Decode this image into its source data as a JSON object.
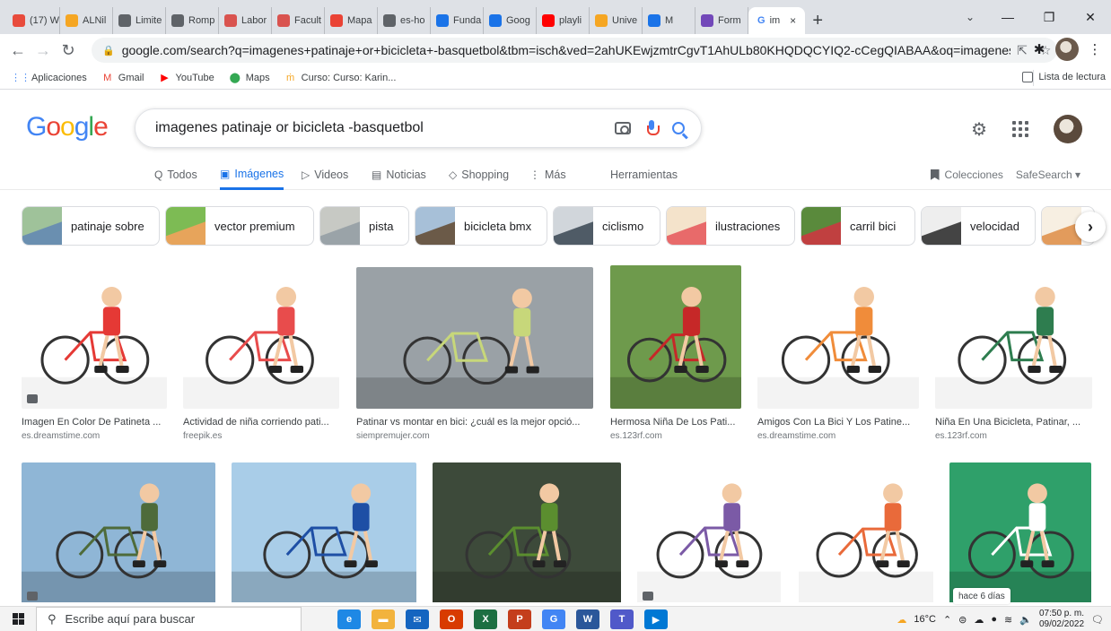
{
  "browser": {
    "tabs": [
      {
        "label": "(17) W",
        "color": "#e84b3c"
      },
      {
        "label": "ALNil",
        "color": "#f5a623"
      },
      {
        "label": "Limite",
        "color": "#5f6368"
      },
      {
        "label": "Romp",
        "color": "#5f6368"
      },
      {
        "label": "Labor",
        "color": "#d9534f"
      },
      {
        "label": "Facult",
        "color": "#d9534f"
      },
      {
        "label": "Mapa",
        "color": "#ea4335"
      },
      {
        "label": "es-ho",
        "color": "#5f6368"
      },
      {
        "label": "Funda",
        "color": "#1a73e8"
      },
      {
        "label": "Goog",
        "color": "#1a73e8"
      },
      {
        "label": "playli",
        "color": "#ff0000"
      },
      {
        "label": "Unive",
        "color": "#f5a623"
      },
      {
        "label": "M",
        "color": "#1a73e8"
      },
      {
        "label": "Form",
        "color": "#7248b9"
      }
    ],
    "active_tab": {
      "label": "im",
      "close": "×"
    },
    "new_tab": "+",
    "url": "google.com/search?q=imagenes+patinaje+or+bicicleta+-basquetbol&tbm=isch&ved=2ahUKEwjzmtrCgvT1AhULb80KHQDQCYIQ2-cCegQIABAA&oq=imagenes+patin...",
    "bookmarks": [
      {
        "label": "Aplicaciones",
        "icon": "apps-grid-icon",
        "color": "#4285f4"
      },
      {
        "label": "Gmail",
        "icon": "gmail-icon",
        "color": "#ea4335"
      },
      {
        "label": "YouTube",
        "icon": "youtube-icon",
        "color": "#ff0000"
      },
      {
        "label": "Maps",
        "icon": "maps-pin-icon",
        "color": "#34a853"
      },
      {
        "label": "Curso: Curso: Karin...",
        "icon": "moodle-icon",
        "color": "#f5a623"
      }
    ],
    "reading_list": "Lista de lectura"
  },
  "google": {
    "logo": [
      "G",
      "o",
      "o",
      "g",
      "l",
      "e"
    ],
    "query": "imagenes patinaje or bicicleta -basquetbol",
    "tabs": [
      {
        "label": "Todos",
        "icon": "search-icon"
      },
      {
        "label": "Imágenes",
        "icon": "image-icon",
        "active": true
      },
      {
        "label": "Videos",
        "icon": "video-icon"
      },
      {
        "label": "Noticias",
        "icon": "news-icon"
      },
      {
        "label": "Shopping",
        "icon": "tag-icon"
      },
      {
        "label": "Más",
        "icon": "more-vertical-icon"
      }
    ],
    "tools": "Herramientas",
    "collections": "Colecciones",
    "safesearch": "SafeSearch"
  },
  "chips": [
    {
      "label": "patinaje sobre",
      "colors": [
        "#9fc29a",
        "#6a8fb0"
      ]
    },
    {
      "label": "vector premium",
      "colors": [
        "#7dbb54",
        "#e7a45b"
      ]
    },
    {
      "label": "pista",
      "colors": [
        "#c7c9c4",
        "#9aa3a8"
      ]
    },
    {
      "label": "bicicleta bmx",
      "colors": [
        "#a7c0d8",
        "#6b5a48"
      ]
    },
    {
      "label": "ciclismo",
      "colors": [
        "#d1d6db",
        "#4f5b66"
      ]
    },
    {
      "label": "ilustraciones",
      "colors": [
        "#f4e3cb",
        "#e86a6a"
      ]
    },
    {
      "label": "carril bici",
      "colors": [
        "#5a8a3c",
        "#c04040"
      ]
    },
    {
      "label": "velocidad",
      "colors": [
        "#eeeeee",
        "#444444"
      ]
    },
    {
      "label": "",
      "colors": [
        "#f7efe2",
        "#e29b5c"
      ]
    }
  ],
  "results_row1": [
    {
      "title": "Imagen En Color De Patineta ...",
      "source": "es.dreamstime.com",
      "bg": "#ffffff",
      "accent": "#e53935"
    },
    {
      "title": "Actividad de niña corriendo pati...",
      "source": "freepik.es",
      "bg": "#ffffff",
      "accent": "#e84c4c"
    },
    {
      "title": "Patinar vs montar en bici: ¿cuál es la mejor opció...",
      "source": "siempremujer.com",
      "bg": "#9aa1a6",
      "accent": "#c7d77a"
    },
    {
      "title": "Hermosa Niña De Los Pati...",
      "source": "es.123rf.com",
      "bg": "#6e9a4c",
      "accent": "#c62828"
    },
    {
      "title": "Amigos Con La Bici Y Los Patine...",
      "source": "es.dreamstime.com",
      "bg": "#ffffff",
      "accent": "#f08c3a"
    },
    {
      "title": "Niña En Una Bicicleta, Patinar, ...",
      "source": "es.123rf.com",
      "bg": "#ffffff",
      "accent": "#2e7d4f"
    }
  ],
  "results_row2": [
    {
      "bg": "#8fb6d6",
      "accent": "#4e6b3a"
    },
    {
      "bg": "#a9cde8",
      "accent": "#1e4fa5"
    },
    {
      "bg": "#3d4a3a",
      "accent": "#5b8e2f"
    },
    {
      "bg": "#ffffff",
      "accent": "#7b5aa6"
    },
    {
      "bg": "#ffffff",
      "accent": "#e96a3a"
    },
    {
      "bg": "#2fa06a",
      "accent": "#ffffff"
    }
  ],
  "new_badge": "hace 6 días",
  "taskbar": {
    "search_placeholder": "Escribe aquí para buscar",
    "apps": [
      {
        "label": "e",
        "color": "#1e88e5"
      },
      {
        "label": "▬",
        "color": "#f2b33d"
      },
      {
        "label": "✉",
        "color": "#1565c0"
      },
      {
        "label": "O",
        "color": "#d83b01"
      },
      {
        "label": "X",
        "color": "#1d6f42"
      },
      {
        "label": "P",
        "color": "#c43e1c"
      },
      {
        "label": "G",
        "color": "#4285f4"
      },
      {
        "label": "W",
        "color": "#2b579a"
      },
      {
        "label": "T",
        "color": "#5059c9"
      },
      {
        "label": "▶",
        "color": "#0078d4"
      }
    ],
    "temperature": "16°C",
    "time": "07:50 p. m.",
    "date": "09/02/2022"
  }
}
